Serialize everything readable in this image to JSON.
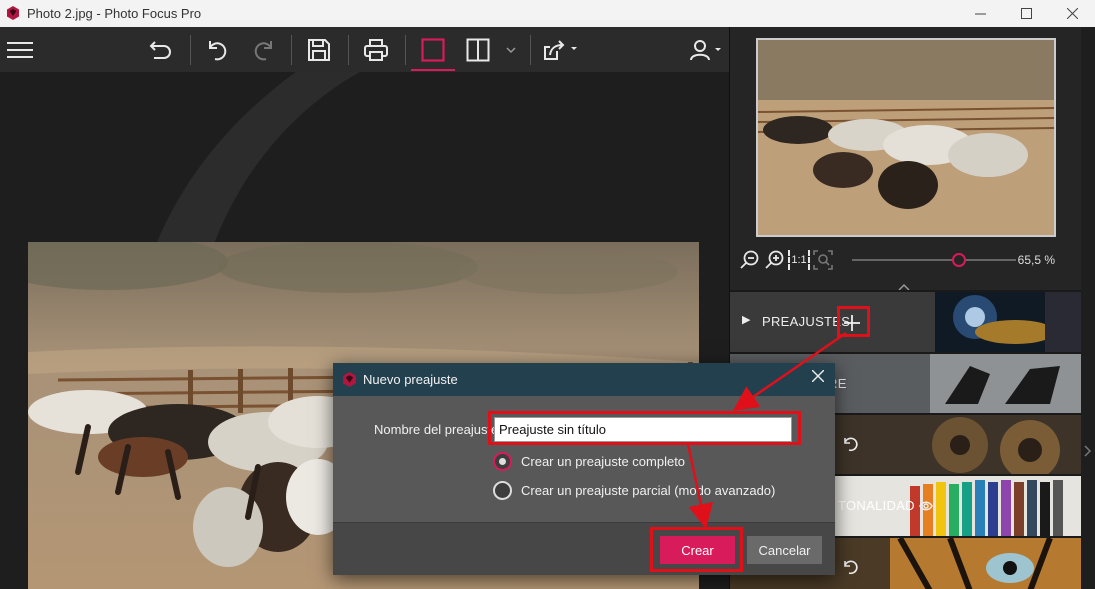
{
  "window": {
    "title": "Photo 2.jpg - Photo Focus Pro",
    "controls": {
      "minimize": "—",
      "maximize": "☐",
      "close": "✕"
    }
  },
  "toolbar": {
    "items": [
      {
        "name": "menu-icon",
        "tooltip": ""
      },
      {
        "name": "back-icon"
      },
      {
        "name": "undo-icon"
      },
      {
        "name": "redo-icon"
      },
      {
        "name": "save-icon"
      },
      {
        "name": "print-icon"
      },
      {
        "name": "single-view-icon",
        "active": true
      },
      {
        "name": "split-view-icon"
      },
      {
        "name": "share-icon"
      },
      {
        "name": "user-icon"
      }
    ],
    "accent": "#d81b5a"
  },
  "navigator": {
    "zoom_percent": "65,5 %",
    "zoom_value": 65.5,
    "zoom_fit_label": "1:1"
  },
  "panel": {
    "sections": [
      {
        "label": "PREAJUSTES",
        "arrow": "▶"
      },
      {
        "label": "RE",
        "arrow": ""
      },
      {
        "label": "",
        "arrow": ""
      },
      {
        "label": "TONALIDAD",
        "arrow": ""
      },
      {
        "label": "",
        "arrow": ""
      }
    ],
    "add_preset": "+"
  },
  "dialog": {
    "title": "Nuevo preajuste",
    "close": "✕",
    "field_label": "Nombre del preajuste",
    "field_value": "Preajuste sin título",
    "options": [
      {
        "label": "Crear un preajuste completo",
        "selected": true
      },
      {
        "label": "Crear un preajuste parcial (modo avanzado)",
        "selected": false
      }
    ],
    "primary_button": "Crear",
    "secondary_button": "Cancelar"
  },
  "colors": {
    "accent": "#d81b5a",
    "annotation": "#e0101b",
    "dialog_header": "#22404e"
  }
}
